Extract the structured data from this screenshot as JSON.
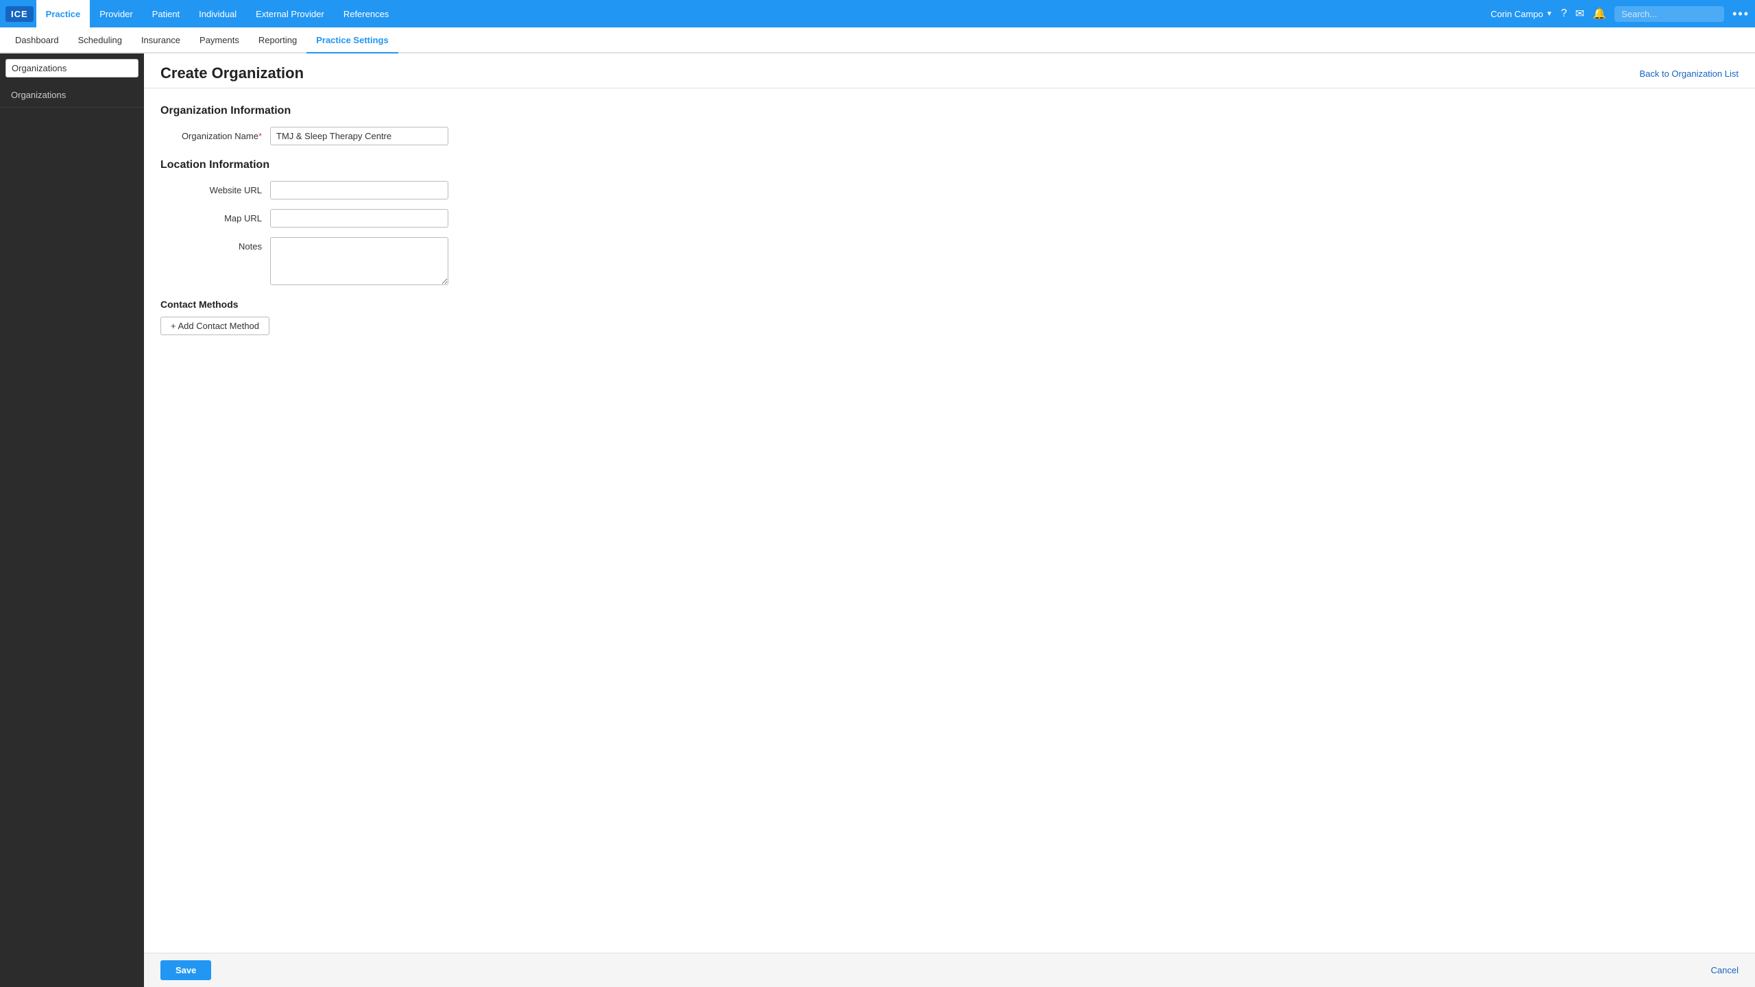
{
  "app": {
    "logo": "ICE",
    "top_nav": [
      {
        "label": "Practice",
        "active": true
      },
      {
        "label": "Provider",
        "active": false
      },
      {
        "label": "Patient",
        "active": false
      },
      {
        "label": "Individual",
        "active": false
      },
      {
        "label": "External Provider",
        "active": false
      },
      {
        "label": "References",
        "active": false
      }
    ],
    "user": "Corin Campo",
    "search_placeholder": "Search...",
    "more_icon": "•••"
  },
  "sub_nav": [
    {
      "label": "Dashboard",
      "active": false
    },
    {
      "label": "Scheduling",
      "active": false
    },
    {
      "label": "Insurance",
      "active": false
    },
    {
      "label": "Payments",
      "active": false
    },
    {
      "label": "Reporting",
      "active": false
    },
    {
      "label": "Practice Settings",
      "active": true
    }
  ],
  "sidebar": {
    "search_value": "Organizations",
    "items": [
      {
        "label": "Organizations"
      }
    ]
  },
  "page": {
    "title": "Create Organization",
    "back_link": "Back to Organization List",
    "sections": {
      "org_info": {
        "title": "Organization Information",
        "fields": [
          {
            "label": "Organization Name",
            "required": true,
            "value": "TMJ & Sleep Therapy Centre",
            "placeholder": ""
          }
        ]
      },
      "location_info": {
        "title": "Location Information",
        "fields": [
          {
            "label": "Website URL",
            "value": "",
            "placeholder": ""
          },
          {
            "label": "Map URL",
            "value": "",
            "placeholder": ""
          },
          {
            "label": "Notes",
            "value": "",
            "placeholder": "",
            "type": "textarea"
          }
        ]
      },
      "contact_methods": {
        "title": "Contact Methods",
        "add_button": "+ Add Contact Method"
      }
    }
  },
  "footer": {
    "save_label": "Save",
    "cancel_label": "Cancel"
  }
}
